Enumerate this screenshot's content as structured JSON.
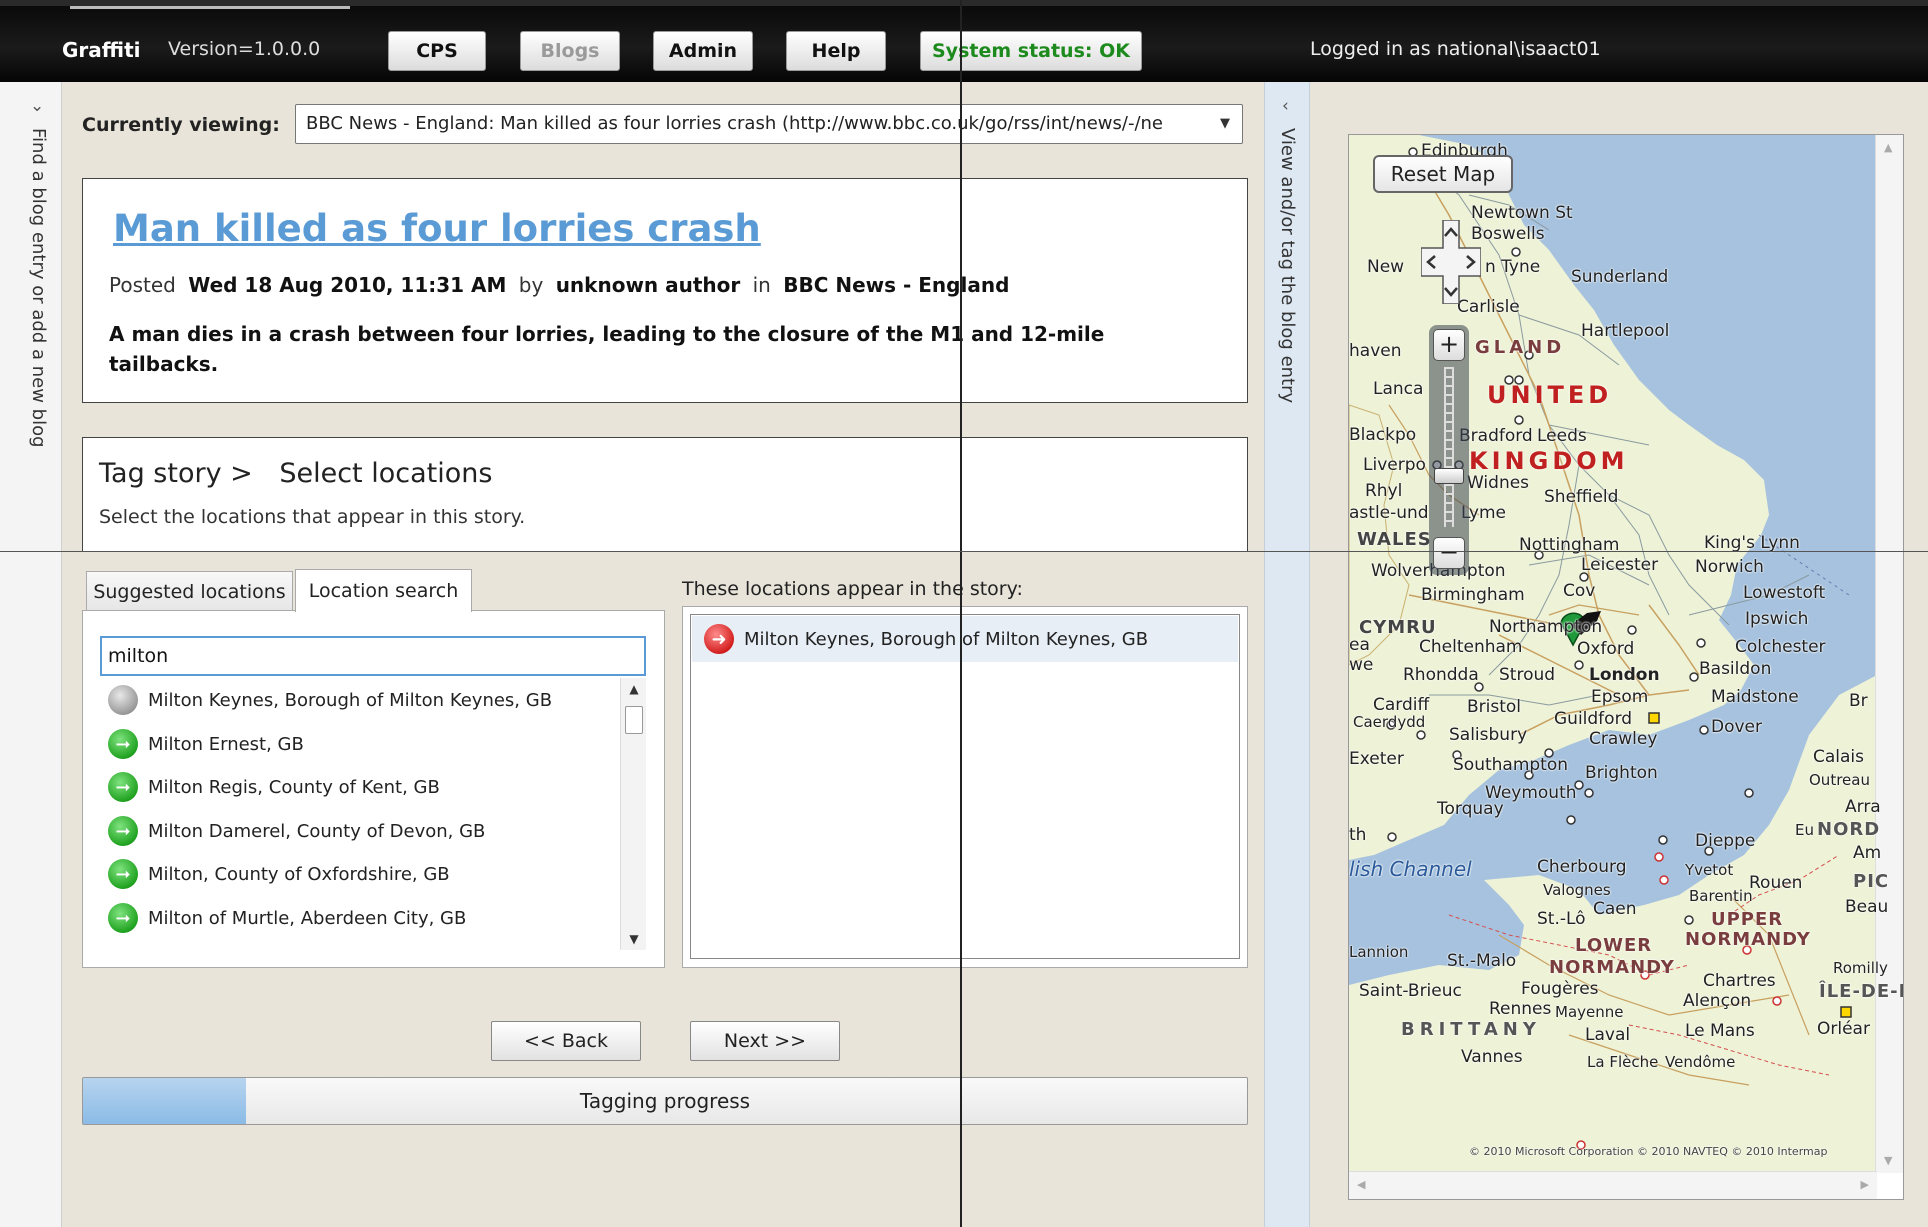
{
  "header": {
    "brand": "Graffiti",
    "version": "Version=1.0.0.0",
    "nav": {
      "cps": "CPS",
      "blogs": "Blogs",
      "admin": "Admin",
      "help": "Help",
      "status": "System status: OK"
    },
    "login": "Logged in as national\\isaact01"
  },
  "left_panel": {
    "label": "Find a blog entry or add a new blog"
  },
  "right_panel": {
    "label": "View and/or tag the blog entry"
  },
  "viewing": {
    "label": "Currently viewing:",
    "value": "BBC News - England: Man killed as four lorries crash (http://www.bbc.co.uk/go/rss/int/news/-/ne"
  },
  "story": {
    "title": "Man killed as four lorries crash",
    "posted_label": "Posted",
    "date": "Wed 18 Aug 2010, 11:31 AM",
    "by_label": "by",
    "author": "unknown author",
    "in_label": "in",
    "source": "BBC News - England",
    "summary": "A man dies in a crash between four lorries, leading to the closure of the M1 and 12-mile tailbacks."
  },
  "tagging": {
    "breadcrumb_root": "Tag story >",
    "breadcrumb_step": "Select locations",
    "instructions": "Select the locations that appear in this story."
  },
  "tabs": {
    "suggested": "Suggested locations",
    "search": "Location search"
  },
  "search": {
    "value": "milton",
    "results": [
      {
        "label": "Milton Keynes, Borough of Milton Keynes, GB",
        "state": "selected"
      },
      {
        "label": "Milton Ernest, GB",
        "state": "add"
      },
      {
        "label": "Milton Regis, County of Kent, GB",
        "state": "add"
      },
      {
        "label": "Milton Damerel, County of Devon, GB",
        "state": "add"
      },
      {
        "label": "Milton, County of Oxfordshire, GB",
        "state": "add"
      },
      {
        "label": "Milton of Murtle, Aberdeen City, GB",
        "state": "add"
      }
    ]
  },
  "appear": {
    "label": "These locations appear in the story:",
    "items": [
      "Milton Keynes, Borough of Milton Keynes, GB"
    ]
  },
  "buttons": {
    "back": "<< Back",
    "next": "Next >>"
  },
  "progress": {
    "label": "Tagging progress",
    "fraction": 0.14
  },
  "map": {
    "reset": "Reset Map",
    "zoom_in": "+",
    "zoom_out": "−",
    "labels": {
      "edinburgh": "Edinburgh",
      "newtown": "Newtown St",
      "boswells": "Boswells",
      "newcastle_part": "New",
      "tyne_part": "n Tyne",
      "sunderland": "Sunderland",
      "carlisle": "Carlisle",
      "hartlepool": "Hartlepool",
      "haven_part": "haven",
      "england_part": "GLAND",
      "lancaster_part": "Lanca",
      "united": "UNITED",
      "kingdom": "KINGDOM",
      "blackpool_part": "Blackpo",
      "bradford": "Bradford",
      "leeds": "Leeds",
      "liverpool_part": "Liverpo",
      "rhyl": "Rhyl",
      "widnes": "Widnes",
      "sheffield": "Sheffield",
      "castle_part": "astle-und",
      "lyme_part": "Lyme",
      "wales": "WALES",
      "nottingham": "Nottingham",
      "kings_lynn": "King's Lynn",
      "wolverhampton": "Wolverhampton",
      "leicester": "Leicester",
      "norwich": "Norwich",
      "birmingham": "Birmingham",
      "coventry_part": "Cov",
      "lowestoft": "Lowestoft",
      "cymru": "CYMRU",
      "northampton": "Northampton",
      "ipswich": "Ipswich",
      "cheltenham": "Cheltenham",
      "oxford": "Oxford",
      "colchester": "Colchester",
      "rhondda": "Rhondda",
      "stroud": "Stroud",
      "london": "London",
      "basildon": "Basildon",
      "cardiff": "Cardiff",
      "caerdydd": "Caerdydd",
      "bristol": "Bristol",
      "epsom": "Epsom",
      "maidstone": "Maidstone",
      "guildford": "Guildford",
      "dover": "Dover",
      "salisbury": "Salisbury",
      "crawley": "Crawley",
      "exeter": "Exeter",
      "southampton": "Southampton",
      "brighton": "Brighton",
      "calais": "Calais",
      "weymouth": "Weymouth",
      "outreau_part": "Outreau",
      "torquay": "Torquay",
      "arras_part": "Arra",
      "nord_part": "NORD",
      "dieppe": "Dieppe",
      "channel": "lish Channel",
      "cherbourg": "Cherbourg",
      "valognes": "Valognes",
      "yvetot": "Yvetot",
      "rouen": "Rouen",
      "barentin": "Barentin",
      "caen": "Caen",
      "st_lo": "St.-Lô",
      "upper_normandy": "UPPER",
      "normandy_a": "NORMANDY",
      "lower": "LOWER",
      "normandy_b": "NORMANDY",
      "lannion": "Lannion",
      "st_malo": "St.-Malo",
      "saint_brieuc": "Saint-Brieuc",
      "fougeres": "Fougères",
      "chartres": "Chartres",
      "alencon": "Alençon",
      "rennes": "Rennes",
      "mayenne": "Mayenne",
      "brittany": "BRITTANY",
      "laval": "Laval",
      "le_mans": "Le Mans",
      "vannes": "Vannes",
      "la_fleche": "La Flèche",
      "vendome": "Vendôme",
      "orleans_part": "Orléar",
      "ile_de_part": "ÎLE-DE-I",
      "romilly_part": "Romilly",
      "beau_part": "Beau",
      "pic_part": "PIC",
      "am_part": "Am",
      "eu": "Eu",
      "dover_br": "Br",
      "th_part": "th",
      "ea_part": "ea",
      "we_part": "we",
      "copyright": "© 2010 Microsoft Corporation   © 2010 NAVTEQ   © 2010 Intermap"
    }
  },
  "colors": {
    "header_bg": "#111111",
    "link": "#5b9bd5",
    "status_ok": "#1d8a1d",
    "progress_fill": "#9fc6ea",
    "marker": "#1f9a3a",
    "map_land": "#eef2d6",
    "map_sea": "#a6c2de"
  }
}
